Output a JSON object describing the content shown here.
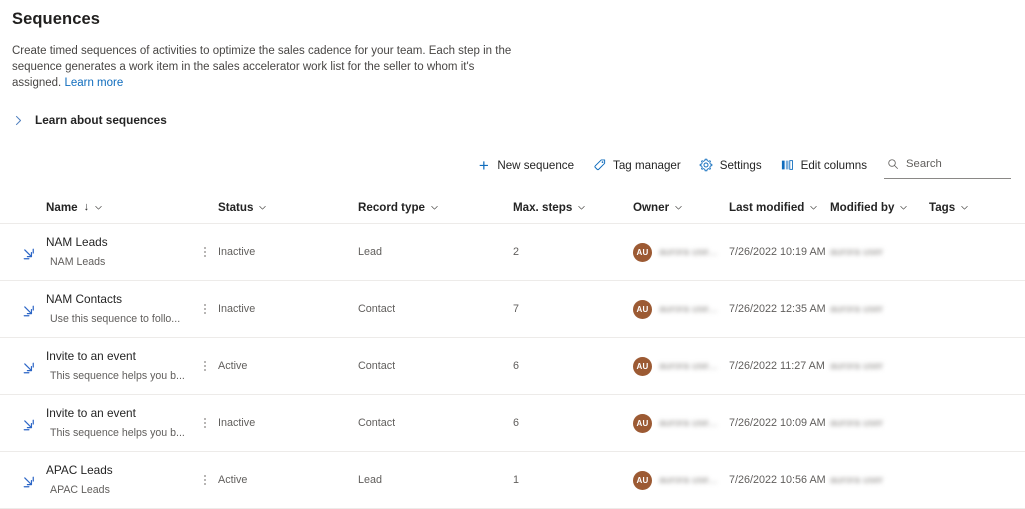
{
  "page": {
    "title": "Sequences",
    "description_part1": "Create timed sequences of activities to optimize the sales cadence for your team. Each step in the sequence generates a work item in the sales accelerator work list for the seller to whom it's assigned. ",
    "learn_more": "Learn more",
    "expander_label": "Learn about sequences"
  },
  "commandbar": {
    "new_sequence": "New sequence",
    "tag_manager": "Tag manager",
    "settings": "Settings",
    "edit_columns": "Edit columns",
    "search_placeholder": "Search",
    "search_value": ""
  },
  "grid": {
    "columns": [
      {
        "label": "Name",
        "sorted": "↓"
      },
      {
        "label": "Status"
      },
      {
        "label": "Record type"
      },
      {
        "label": "Max. steps"
      },
      {
        "label": "Owner"
      },
      {
        "label": "Last modified"
      },
      {
        "label": "Modified by"
      },
      {
        "label": "Tags"
      }
    ],
    "rows": [
      {
        "name": "NAM Leads",
        "subtitle": "NAM Leads",
        "status": "Inactive",
        "record_type": "Lead",
        "max_steps": "2",
        "owner_initials": "AU",
        "owner_name": "aurora use...",
        "last_modified": "7/26/2022 10:19 AM",
        "modified_by": "aurora user",
        "tags": ""
      },
      {
        "name": "NAM Contacts",
        "subtitle": "Use this sequence to follo...",
        "status": "Inactive",
        "record_type": "Contact",
        "max_steps": "7",
        "owner_initials": "AU",
        "owner_name": "aurora use...",
        "last_modified": "7/26/2022 12:35 AM",
        "modified_by": "aurora user",
        "tags": ""
      },
      {
        "name": "Invite to an event",
        "subtitle": "This sequence helps you b...",
        "status": "Active",
        "record_type": "Contact",
        "max_steps": "6",
        "owner_initials": "AU",
        "owner_name": "aurora use...",
        "last_modified": "7/26/2022 11:27 AM",
        "modified_by": "aurora user",
        "tags": ""
      },
      {
        "name": "Invite to an event",
        "subtitle": "This sequence helps you b...",
        "status": "Inactive",
        "record_type": "Contact",
        "max_steps": "6",
        "owner_initials": "AU",
        "owner_name": "aurora use...",
        "last_modified": "7/26/2022 10:09 AM",
        "modified_by": "aurora user",
        "tags": ""
      },
      {
        "name": "APAC Leads",
        "subtitle": "APAC Leads",
        "status": "Active",
        "record_type": "Lead",
        "max_steps": "1",
        "owner_initials": "AU",
        "owner_name": "aurora use...",
        "last_modified": "7/26/2022 10:56 AM",
        "modified_by": "aurora user",
        "tags": ""
      }
    ]
  },
  "colors": {
    "link": "#0f6cbd",
    "icon_blue": "#2b65c6",
    "avatar": "#9c5a33",
    "divider": "#edebe9"
  }
}
